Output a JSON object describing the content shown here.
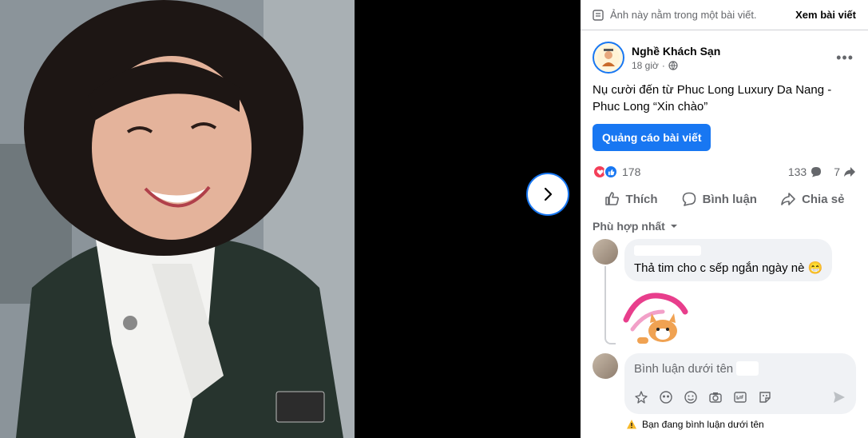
{
  "notice": {
    "text": "Ảnh này nằm trong một bài viết.",
    "see_post": "Xem bài viết"
  },
  "post": {
    "page_name": "Nghề Khách Sạn",
    "time": "18 giờ",
    "caption": "Nụ cười đến từ Phuc Long Luxury Da Nang - Phuc Long “Xin chào”",
    "boost_label": "Quảng cáo bài viết"
  },
  "stats": {
    "reactions": "178",
    "comments": "133",
    "shares": "7"
  },
  "actions": {
    "like": "Thích",
    "comment": "Bình luận",
    "share": "Chia sẻ"
  },
  "sort_label": "Phù hợp nhất",
  "comment": {
    "text": "Thả tim cho c sếp ngắn ngày nè 😁"
  },
  "composer": {
    "placeholder": "Bình luận dưới tên",
    "warning": "Bạn đang bình luận dưới tên"
  },
  "colors": {
    "accent": "#1877f2",
    "heart": "#f33e58"
  }
}
